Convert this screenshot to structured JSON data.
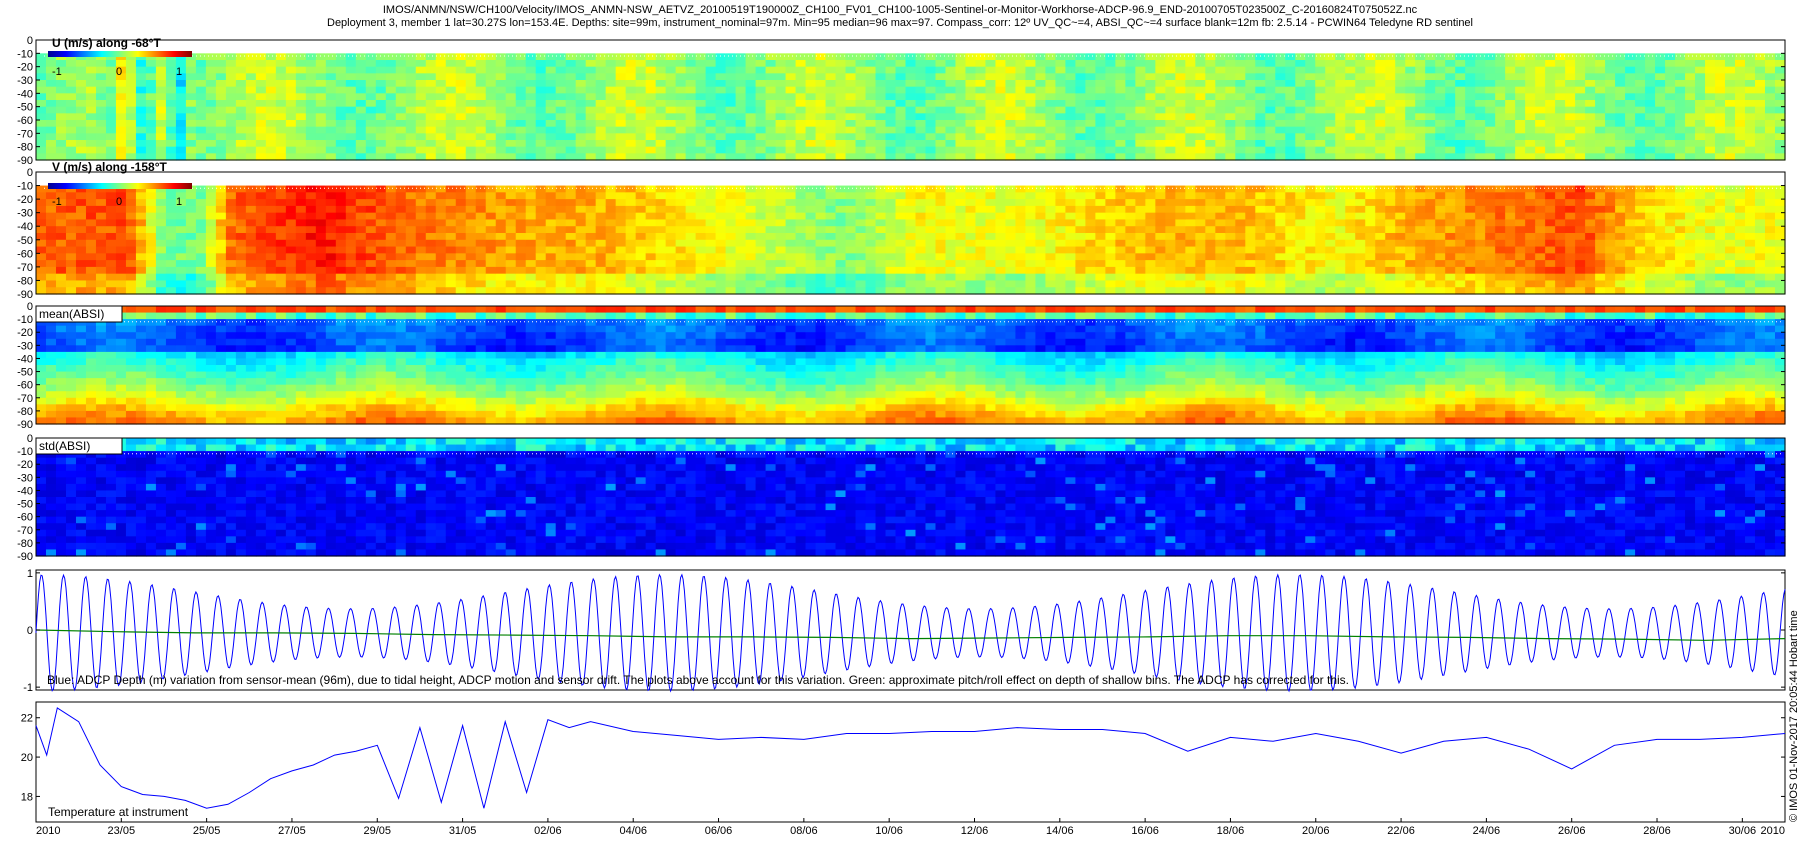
{
  "header": {
    "title_line1": "IMOS/ANMN/NSW/CH100/Velocity/IMOS_ANMN-NSW_AETVZ_20100519T190000Z_CH100_FV01_CH100-1005-Sentinel-or-Monitor-Workhorse-ADCP-96.9_END-20100705T023500Z_C-20160824T075052Z.nc",
    "title_line2": "Deployment 3, member 1 lat=30.27S lon=153.4E. Depths: site=99m, instrument_nominal=97m. Min=95 median=96 max=97. Compass_corr: 12º UV_QC~=4, ABSI_QC~=4 surface blank=12m fb: 2.5.14 - PCWIN64 Teledyne RD sentinel"
  },
  "side_label": "© IMOS 01-Nov-2017 20:05:44 Hobart time",
  "chart_data": [
    {
      "type": "heatmap",
      "title": "U (m/s) along -68°T",
      "ylim": [
        -90,
        0
      ],
      "yticks": [
        0,
        -10,
        -20,
        -30,
        -40,
        -50,
        -60,
        -70,
        -80,
        -90
      ],
      "colorbar_ticks": [
        -1,
        0,
        1
      ],
      "colormap": "jet"
    },
    {
      "type": "heatmap",
      "title": "V (m/s) along -158°T",
      "ylim": [
        -90,
        0
      ],
      "yticks": [
        0,
        -10,
        -20,
        -30,
        -40,
        -50,
        -60,
        -70,
        -80,
        -90
      ],
      "colorbar_ticks": [
        -1,
        0,
        1
      ],
      "colormap": "jet"
    },
    {
      "type": "heatmap",
      "title": "mean(ABSI)",
      "ylim": [
        -90,
        0
      ],
      "yticks": [
        0,
        -10,
        -20,
        -30,
        -40,
        -50,
        -60,
        -70,
        -80,
        -90
      ],
      "colormap": "jet"
    },
    {
      "type": "heatmap",
      "title": "std(ABSI)",
      "ylim": [
        -90,
        0
      ],
      "yticks": [
        0,
        -10,
        -20,
        -30,
        -40,
        -50,
        -60,
        -70,
        -80,
        -90
      ],
      "colormap": "jet"
    },
    {
      "type": "line",
      "ylim": [
        -1.05,
        1.05
      ],
      "yticks": [
        1,
        0,
        -1
      ],
      "annotation": "Blue: ADCP Depth (m) variation from sensor-mean (96m), due to tidal height, ADCP motion and sensor drift. The plots above account for this variation. Green: approximate pitch/roll effect on depth of shallow bins. The ADCP has corrected for this.",
      "series": [
        {
          "color": "#0000ff",
          "tidal_amplitude_range": [
            0.5,
            1.2
          ],
          "tidal_period_hours": 12.42
        },
        {
          "color": "#008000",
          "values": [
            0.0,
            -0.03,
            -0.05,
            -0.05,
            -0.06,
            -0.08,
            -0.09,
            -0.1,
            -0.12,
            -0.12,
            -0.13,
            -0.15,
            -0.14,
            -0.13,
            -0.12,
            -0.1,
            -0.1,
            -0.12,
            -0.13,
            -0.15,
            -0.16,
            -0.18,
            -0.15
          ]
        }
      ]
    },
    {
      "type": "line",
      "ylim": [
        16.7,
        22.8
      ],
      "yticks": [
        22,
        20,
        18
      ],
      "annotation": "Temperature at instrument",
      "x_ticks": [
        "2010",
        "23/05",
        "25/05",
        "27/05",
        "29/05",
        "31/05",
        "02/06",
        "04/06",
        "06/06",
        "08/06",
        "10/06",
        "12/06",
        "14/06",
        "16/06",
        "18/06",
        "20/06",
        "22/06",
        "24/06",
        "26/06",
        "28/06",
        "30/06",
        "2010"
      ],
      "x_start": "2010-05-21",
      "x_end": "2010-07-01",
      "series": [
        {
          "color": "#0000ff",
          "x": [
            "2010-05-21",
            "2010-05-21 06:00",
            "2010-05-21 12:00",
            "2010-05-22",
            "2010-05-22 12:00",
            "2010-05-23",
            "2010-05-23 12:00",
            "2010-05-24",
            "2010-05-24 12:00",
            "2010-05-25",
            "2010-05-25 12:00",
            "2010-05-26",
            "2010-05-26 12:00",
            "2010-05-27",
            "2010-05-27 12:00",
            "2010-05-28",
            "2010-05-28 12:00",
            "2010-05-29",
            "2010-05-29 12:00",
            "2010-05-30",
            "2010-05-30 12:00",
            "2010-05-31",
            "2010-05-31 12:00",
            "2010-06-01",
            "2010-06-01 12:00",
            "2010-06-02",
            "2010-06-02 12:00",
            "2010-06-03",
            "2010-06-04",
            "2010-06-05",
            "2010-06-06",
            "2010-06-07",
            "2010-06-08",
            "2010-06-09",
            "2010-06-10",
            "2010-06-11",
            "2010-06-12",
            "2010-06-13",
            "2010-06-14",
            "2010-06-15",
            "2010-06-16",
            "2010-06-17",
            "2010-06-18",
            "2010-06-19",
            "2010-06-20",
            "2010-06-21",
            "2010-06-22",
            "2010-06-23",
            "2010-06-24",
            "2010-06-25",
            "2010-06-26",
            "2010-06-27",
            "2010-06-28",
            "2010-06-29",
            "2010-06-30",
            "2010-07-01"
          ],
          "values": [
            21.6,
            20.1,
            22.5,
            21.8,
            19.6,
            18.5,
            18.1,
            18.0,
            17.8,
            17.4,
            17.6,
            18.2,
            18.9,
            19.3,
            19.6,
            20.1,
            20.3,
            20.6,
            17.9,
            21.5,
            17.7,
            21.6,
            17.4,
            21.8,
            18.2,
            21.9,
            21.5,
            21.8,
            21.3,
            21.1,
            20.9,
            21.0,
            20.9,
            21.2,
            21.2,
            21.3,
            21.3,
            21.5,
            21.4,
            21.4,
            21.2,
            20.3,
            21.0,
            20.8,
            21.2,
            20.8,
            20.2,
            20.8,
            21.0,
            20.4,
            19.4,
            20.6,
            20.9,
            20.9,
            21.0,
            21.2
          ]
        }
      ]
    }
  ]
}
